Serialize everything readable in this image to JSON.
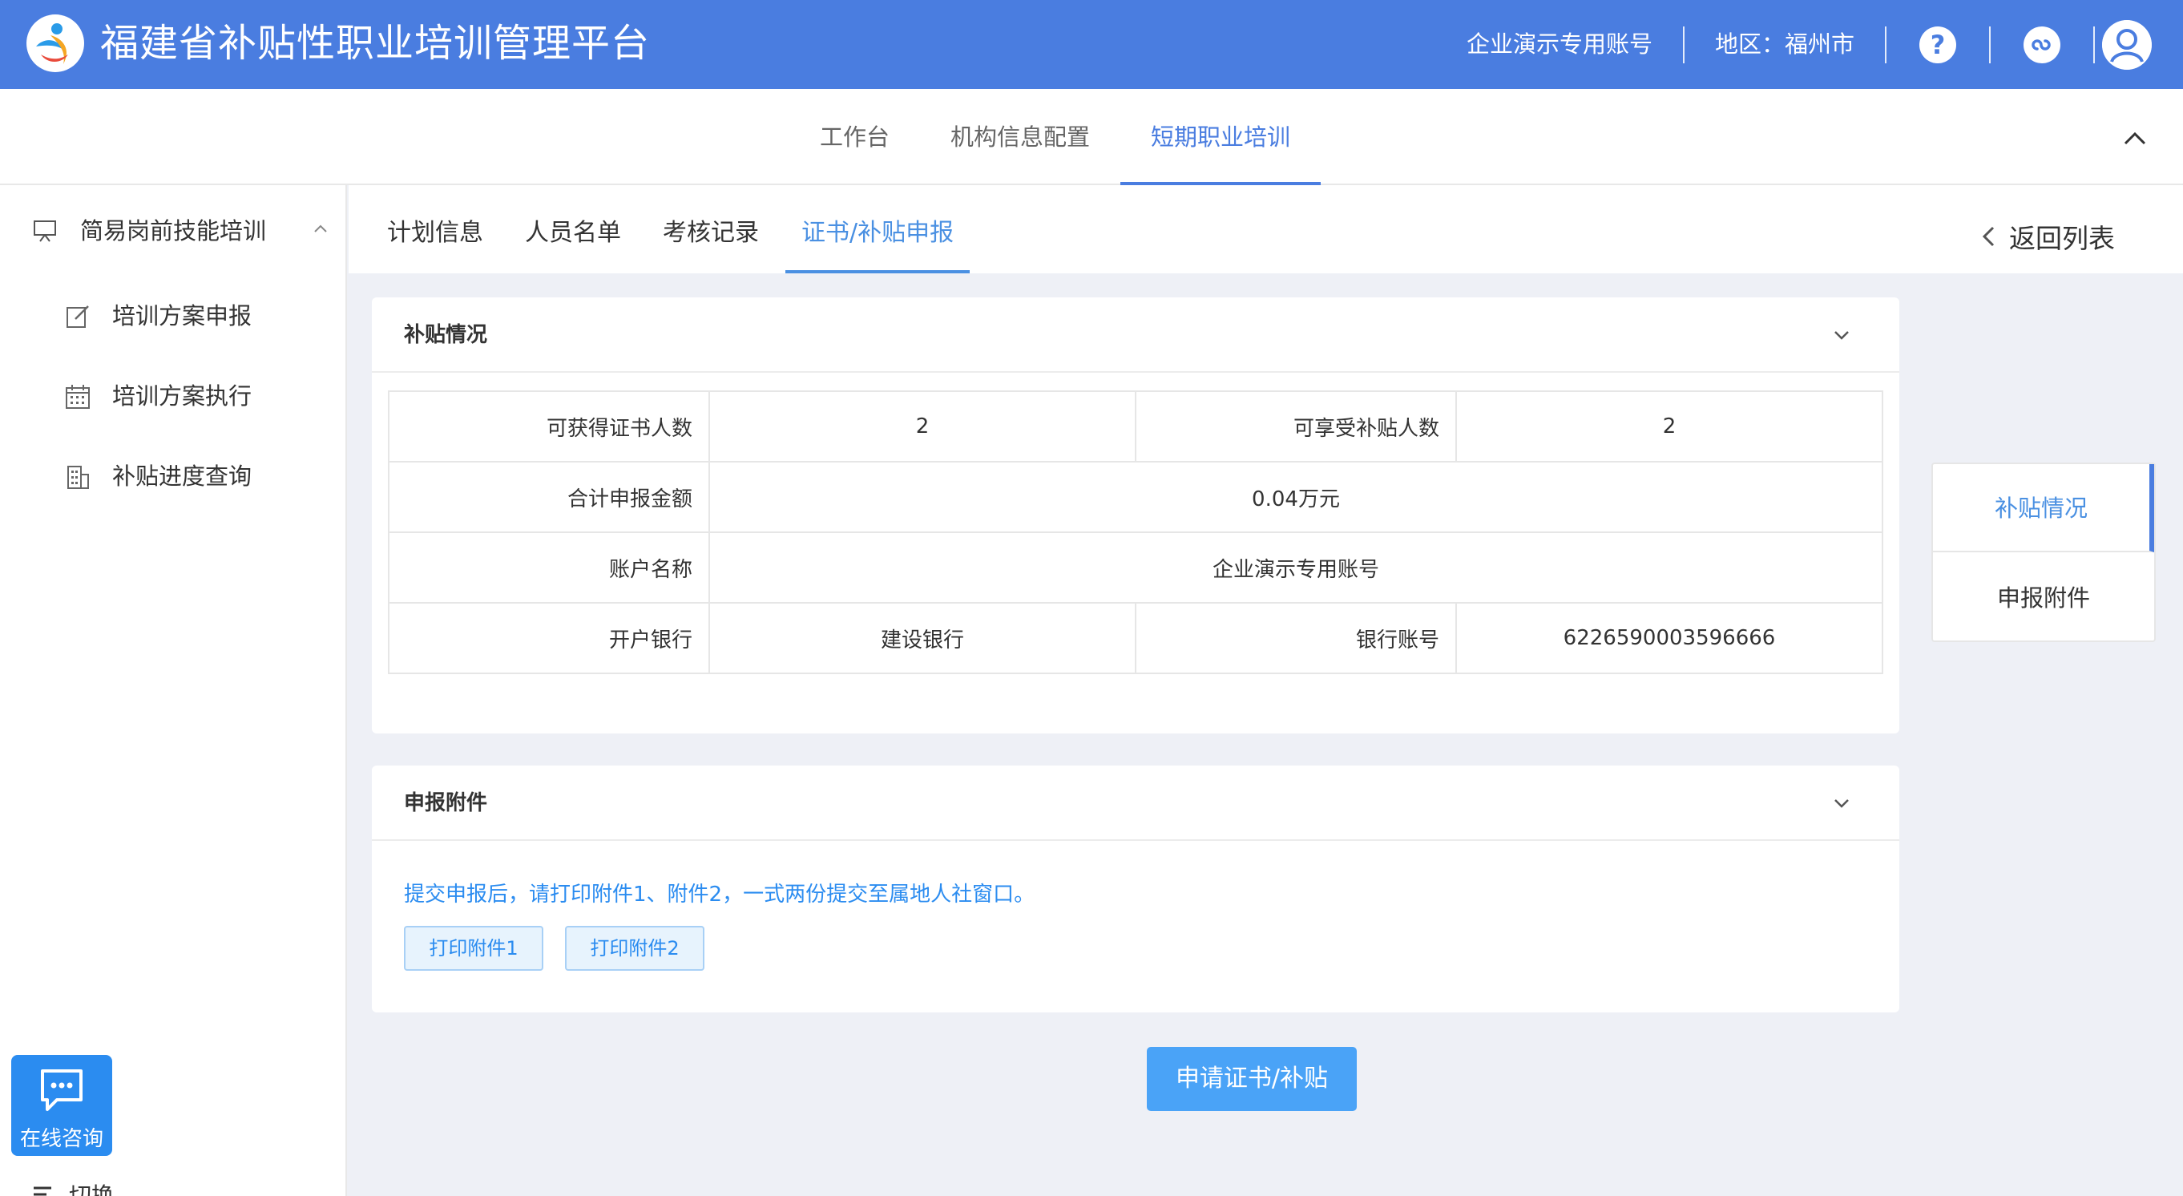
{
  "header": {
    "title": "福建省补贴性职业培训管理平台",
    "account": "企业演示专用账号",
    "region": "地区：福州市",
    "help_icon": "question-icon",
    "link_icon": "mini-program-icon",
    "avatar_icon": "user-avatar-icon"
  },
  "nav": {
    "tabs": [
      {
        "label": "工作台"
      },
      {
        "label": "机构信息配置"
      },
      {
        "label": "短期职业培训"
      }
    ],
    "active_tab": "短期职业培训"
  },
  "sidebar": {
    "group": {
      "label": "简易岗前技能培训",
      "icon": "presentation-board-icon"
    },
    "items": [
      {
        "label": "培训方案申报",
        "icon": "edit-icon"
      },
      {
        "label": "培训方案执行",
        "icon": "calendar-icon"
      },
      {
        "label": "补贴进度查询",
        "icon": "building-icon"
      }
    ],
    "chat": {
      "label": "在线咨询",
      "icon": "chat-bubble-icon"
    },
    "switch_label": "切换"
  },
  "subtabs": {
    "tabs": [
      {
        "label": "计划信息"
      },
      {
        "label": "人员名单"
      },
      {
        "label": "考核记录"
      },
      {
        "label": "证书/补贴申报"
      }
    ],
    "active": "证书/补贴申报",
    "back_label": "返回列表"
  },
  "subsidy": {
    "title": "补贴情况",
    "rows": {
      "cert_count_label": "可获得证书人数",
      "cert_count_value": "2",
      "subsidy_count_label": "可享受补贴人数",
      "subsidy_count_value": "2",
      "total_label": "合计申报金额",
      "total_value": "0.04万元",
      "account_name_label": "账户名称",
      "account_name_value": "企业演示专用账号",
      "bank_label": "开户银行",
      "bank_value": "建设银行",
      "bank_account_label": "银行账号",
      "bank_account_value": "6226590003596666"
    }
  },
  "attachments": {
    "title": "申报附件",
    "notice": "提交申报后，请打印附件1、附件2，一式两份提交至属地人社窗口。",
    "print1": "打印附件1",
    "print2": "打印附件2"
  },
  "submit_label": "申请证书/补贴",
  "anchor": {
    "items": [
      {
        "label": "补贴情况"
      },
      {
        "label": "申报附件"
      }
    ]
  },
  "colors": {
    "header_bg": "#4a7de0",
    "accent": "#4a90e2",
    "button_blue": "#4aa3f7"
  }
}
